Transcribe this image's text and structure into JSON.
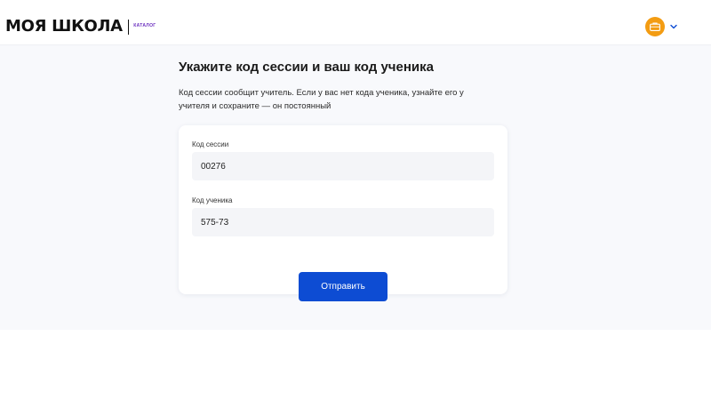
{
  "header": {
    "logo_text": "МОЯ ШКОЛА",
    "logo_sub": "КАТАЛОГ",
    "avatar_icon": "briefcase-icon",
    "avatar_color": "#f39c12",
    "menu_icon": "chevron-down-icon"
  },
  "form": {
    "title": "Укажите код сессии и ваш код ученика",
    "description": "Код сессии сообщит учитель. Если у вас нет кода ученика, узнайте его у учителя и сохраните — он постоянный",
    "session_label": "Код сессии",
    "session_value": "00276",
    "student_label": "Код ученика",
    "student_value": "575-73",
    "submit_label": "Отправить",
    "accent_color": "#0d4cd3"
  }
}
